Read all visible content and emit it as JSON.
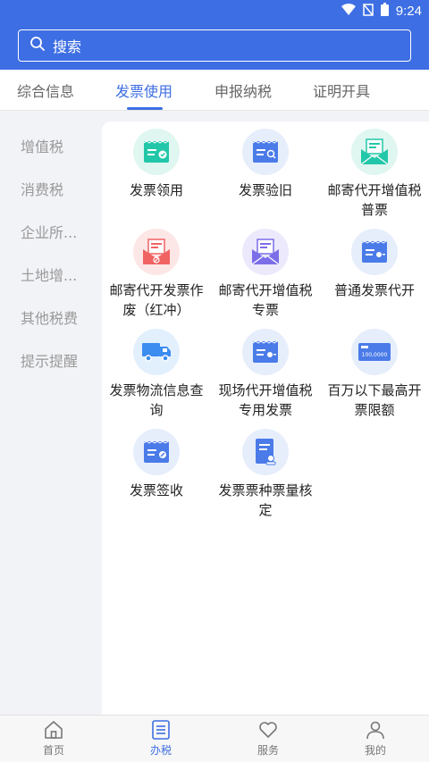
{
  "status": {
    "time": "9:24",
    "wifi_icon": "wifi-icon",
    "signal_icon": "no-signal-icon",
    "battery_icon": "battery-icon"
  },
  "search": {
    "label": "搜索",
    "icon": "search-icon"
  },
  "tabs": [
    {
      "label": "综合信息"
    },
    {
      "label": "发票使用"
    },
    {
      "label": "申报纳税"
    },
    {
      "label": "证明开具"
    }
  ],
  "sidebar": {
    "items": [
      {
        "label": "增值税"
      },
      {
        "label": "消费税"
      },
      {
        "label": "企业所..."
      },
      {
        "label": "土地增..."
      },
      {
        "label": "其他税费"
      },
      {
        "label": "提示提醒"
      }
    ]
  },
  "grid": {
    "items": [
      {
        "label": "发票领用",
        "icon": "invoice-check-icon",
        "color": "#22c7a9"
      },
      {
        "label": "发票验旧",
        "icon": "invoice-search-icon",
        "color": "#4a7be8"
      },
      {
        "label": "邮寄代开增值税普票",
        "icon": "mail-invoice-icon",
        "color": "#22c7a9"
      },
      {
        "label": "邮寄代开发票作废（红冲）",
        "icon": "mail-void-icon",
        "color": "#f06363"
      },
      {
        "label": "邮寄代开增值税专票",
        "icon": "mail-special-invoice-icon",
        "color": "#7b6ee8"
      },
      {
        "label": "普通发票代开",
        "icon": "invoice-issue-icon",
        "color": "#4a7be8"
      },
      {
        "label": "发票物流信息查询",
        "icon": "truck-icon",
        "color": "#3d8cf0"
      },
      {
        "label": "现场代开增值税专用发票",
        "icon": "onsite-invoice-icon",
        "color": "#4a7be8"
      },
      {
        "label": "百万以下最高开票限额",
        "icon": "amount-limit-icon",
        "color": "#4a7be8",
        "amount_text": "100,0000"
      },
      {
        "label": "发票签收",
        "icon": "invoice-sign-icon",
        "color": "#4a7be8"
      },
      {
        "label": "发票票种票量核定",
        "icon": "document-approve-icon",
        "color": "#4a7be8"
      }
    ]
  },
  "bottom_nav": [
    {
      "label": "首页",
      "icon": "home-icon"
    },
    {
      "label": "办税",
      "icon": "list-icon"
    },
    {
      "label": "服务",
      "icon": "heart-icon"
    },
    {
      "label": "我的",
      "icon": "user-icon"
    }
  ],
  "colors": {
    "primary": "#3d6ee3",
    "background": "#f2f3f7"
  }
}
